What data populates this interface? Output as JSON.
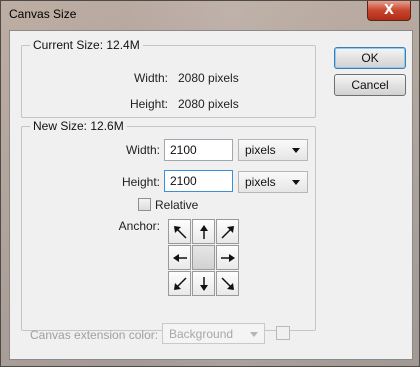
{
  "window": {
    "title": "Canvas Size",
    "close_label": "X"
  },
  "current_size": {
    "legend": "Current Size: 12.4M",
    "width_label": "Width:",
    "width_value": "2080 pixels",
    "height_label": "Height:",
    "height_value": "2080 pixels"
  },
  "new_size": {
    "legend": "New Size: 12.6M",
    "width_label": "Width:",
    "width_value": "2100",
    "width_unit": "pixels",
    "height_label": "Height:",
    "height_value": "2100",
    "height_unit": "pixels",
    "relative_label": "Relative",
    "relative_checked": false,
    "anchor_label": "Anchor:"
  },
  "buttons": {
    "ok": "OK",
    "cancel": "Cancel"
  },
  "extension": {
    "label": "Canvas extension color:",
    "value": "Background"
  },
  "anchor_icons": [
    "arrow-up-left-icon",
    "arrow-up-icon",
    "arrow-up-right-icon",
    "arrow-left-icon",
    "anchor-center",
    "arrow-right-icon",
    "arrow-down-left-icon",
    "arrow-down-icon",
    "arrow-down-right-icon"
  ]
}
